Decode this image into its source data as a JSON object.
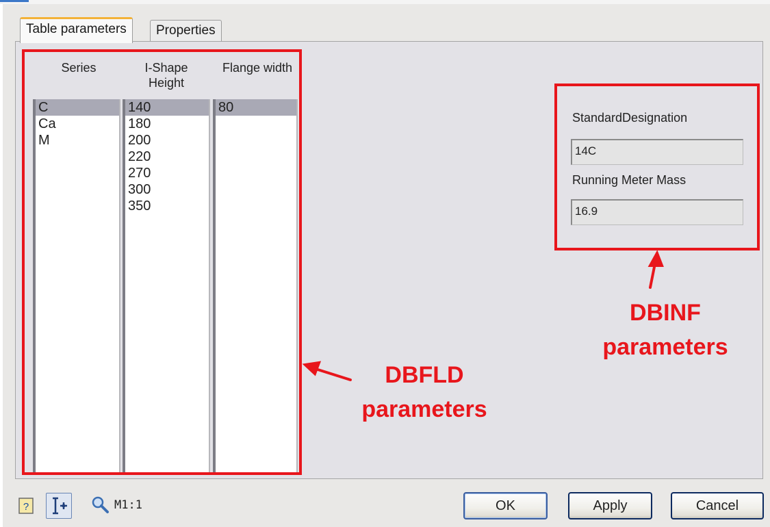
{
  "tabs": [
    {
      "label": "Table parameters",
      "active": true
    },
    {
      "label": "Properties",
      "active": false
    }
  ],
  "columns": {
    "series": {
      "header": "Series",
      "items": [
        "C",
        "Ca",
        "M"
      ],
      "selected": "C"
    },
    "height": {
      "header_line1": "I-Shape",
      "header_line2": "Height",
      "items": [
        "140",
        "180",
        "200",
        "220",
        "270",
        "300",
        "350"
      ],
      "selected": "140"
    },
    "flange": {
      "header": "Flange width",
      "items": [
        "80"
      ],
      "selected": "80"
    }
  },
  "info": {
    "designation_label": "StandardDesignation",
    "designation_value": "14C",
    "mass_label": "Running Meter Mass",
    "mass_value": "16.9"
  },
  "annotations": {
    "dbfld_line1": "DBFLD",
    "dbfld_line2": "parameters",
    "dbinf_line1": "DBINF",
    "dbinf_line2": "parameters",
    "color": "#e8161c"
  },
  "footer": {
    "scale_text": "M1:1",
    "ok_label": "OK",
    "apply_label": "Apply",
    "cancel_label": "Cancel",
    "icons": [
      "help-icon",
      "snap-icon",
      "zoom-icon"
    ]
  }
}
